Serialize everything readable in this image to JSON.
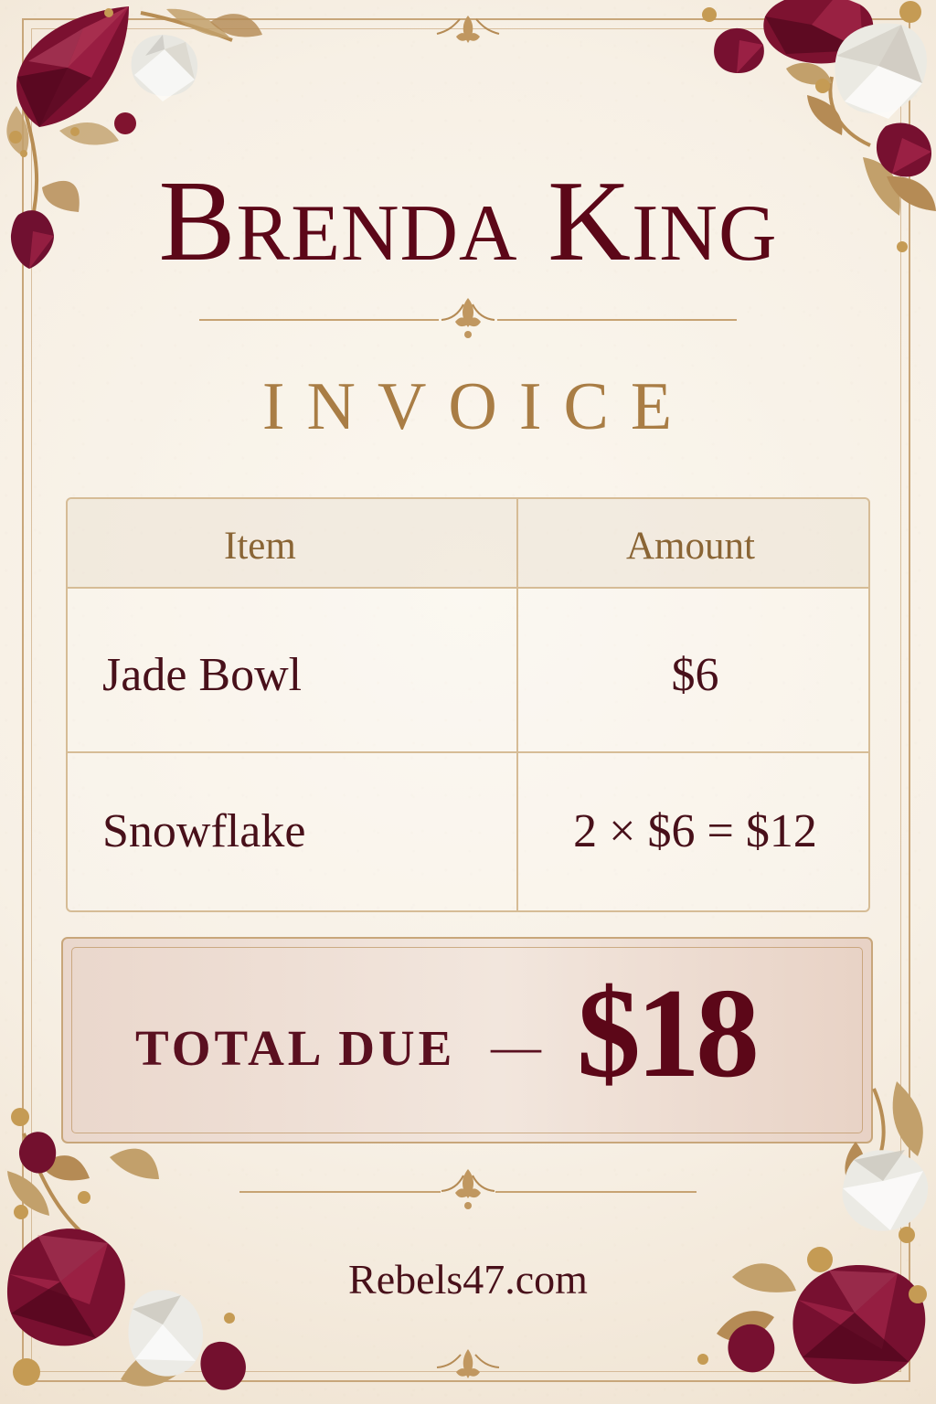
{
  "invoice": {
    "customer_name": "Brenda King",
    "heading": "INVOICE",
    "column_item": "Item",
    "column_amount": "Amount",
    "rows": [
      {
        "item": "Jade Bowl",
        "amount": "$6"
      },
      {
        "item": "Snowflake",
        "amount": "2 × $6 = $12"
      }
    ],
    "total_label": "TOTAL DUE",
    "total_separator": "—",
    "total_amount": "$18",
    "website": "Rebels47.com"
  },
  "colors": {
    "burgundy": "#5c0718",
    "gold": "#a97d45",
    "paper": "#f7f0e5",
    "border": "#d6bc96"
  },
  "icons": [
    "fleur-ornament-icon",
    "ruby-gem-icon",
    "clear-crystal-icon",
    "gold-leaf-icon"
  ]
}
